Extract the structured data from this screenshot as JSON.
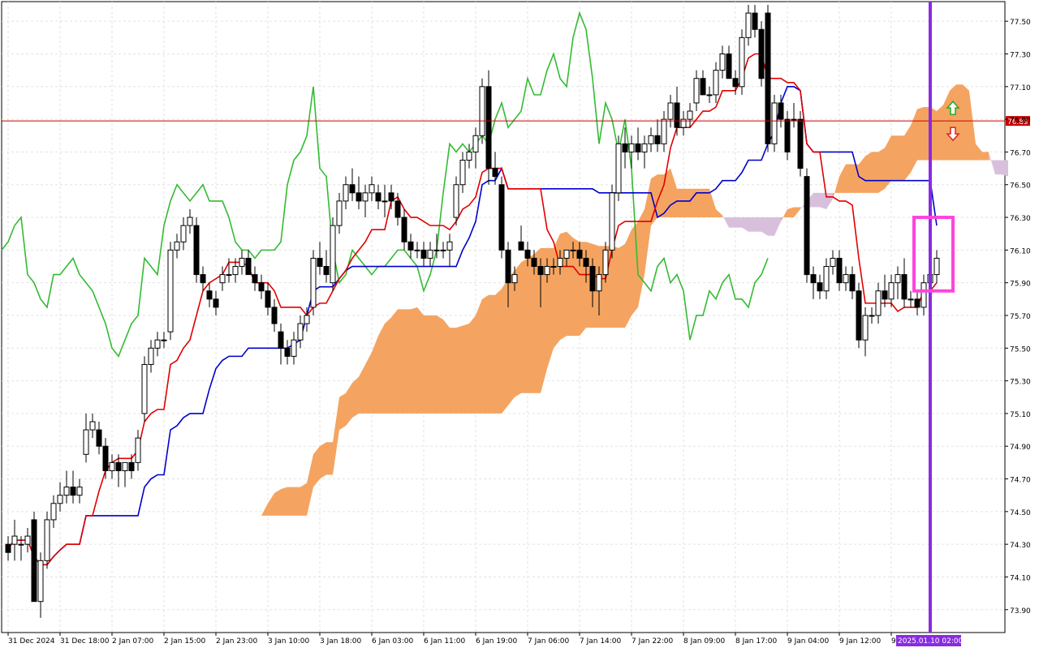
{
  "chart_data": {
    "type": "candlestick",
    "instrument_timeframe": "H1",
    "ylim": [
      73.76,
      77.62
    ],
    "y_ticks": [
      "77.50",
      "77.30",
      "77.10",
      "76.90",
      "76.70",
      "76.50",
      "76.30",
      "76.10",
      "75.90",
      "75.70",
      "75.50",
      "75.30",
      "75.10",
      "74.90",
      "74.70",
      "74.50",
      "74.30",
      "74.10",
      "73.90"
    ],
    "x_tick_labels": [
      "31 Dec 2024",
      "31 Dec 18:00",
      "2 Jan 07:00",
      "2 Jan 15:00",
      "2 Jan 23:00",
      "3 Jan 10:00",
      "3 Jan 18:00",
      "6 Jan 03:00",
      "6 Jan 11:00",
      "6 Jan 19:00",
      "7 Jan 06:00",
      "7 Jan 14:00",
      "7 Jan 22:00",
      "8 Jan 09:00",
      "8 Jan 17:00",
      "9 Jan 04:00",
      "9 Jan 12:00",
      "9"
    ],
    "x_tick_bar_index": [
      0,
      8,
      16,
      24,
      32,
      40,
      48,
      56,
      64,
      72,
      80,
      88,
      96,
      104,
      112,
      120,
      128,
      136
    ],
    "current_price": {
      "value": 76.89,
      "label": "76.89"
    },
    "vertical_marker": {
      "label": "2025.01.10 02:00",
      "bar_index": 142
    },
    "grid": true,
    "candles": [
      {
        "o": 74.3,
        "h": 74.35,
        "l": 74.2,
        "c": 74.25
      },
      {
        "o": 74.3,
        "h": 74.45,
        "l": 74.2,
        "c": 74.35
      },
      {
        "o": 74.3,
        "h": 74.35,
        "l": 74.2,
        "c": 74.3
      },
      {
        "o": 74.3,
        "h": 74.4,
        "l": 74.25,
        "c": 74.35
      },
      {
        "o": 74.45,
        "h": 74.5,
        "l": 73.95,
        "c": 73.95
      },
      {
        "o": 73.95,
        "h": 74.25,
        "l": 73.85,
        "c": 74.2
      },
      {
        "o": 74.2,
        "h": 74.5,
        "l": 74.15,
        "c": 74.45
      },
      {
        "o": 74.45,
        "h": 74.6,
        "l": 74.4,
        "c": 74.55
      },
      {
        "o": 74.55,
        "h": 74.68,
        "l": 74.5,
        "c": 74.6
      },
      {
        "o": 74.6,
        "h": 74.75,
        "l": 74.55,
        "c": 74.65
      },
      {
        "o": 74.65,
        "h": 74.75,
        "l": 74.55,
        "c": 74.6
      },
      {
        "o": 74.6,
        "h": 74.7,
        "l": 74.55,
        "c": 74.65
      },
      {
        "o": 74.85,
        "h": 75.1,
        "l": 74.8,
        "c": 75.0
      },
      {
        "o": 75.0,
        "h": 75.1,
        "l": 74.95,
        "c": 75.05
      },
      {
        "o": 75.0,
        "h": 75.05,
        "l": 74.85,
        "c": 74.9
      },
      {
        "o": 74.9,
        "h": 74.95,
        "l": 74.7,
        "c": 74.75
      },
      {
        "o": 74.75,
        "h": 74.85,
        "l": 74.7,
        "c": 74.8
      },
      {
        "o": 74.8,
        "h": 74.85,
        "l": 74.65,
        "c": 74.75
      },
      {
        "o": 74.75,
        "h": 74.8,
        "l": 74.65,
        "c": 74.8
      },
      {
        "o": 74.8,
        "h": 74.85,
        "l": 74.7,
        "c": 74.75
      },
      {
        "o": 74.8,
        "h": 75.0,
        "l": 74.75,
        "c": 74.95
      },
      {
        "o": 75.1,
        "h": 75.45,
        "l": 75.05,
        "c": 75.4
      },
      {
        "o": 75.4,
        "h": 75.55,
        "l": 75.35,
        "c": 75.5
      },
      {
        "o": 75.5,
        "h": 75.6,
        "l": 75.45,
        "c": 75.55
      },
      {
        "o": 75.55,
        "h": 75.6,
        "l": 75.5,
        "c": 75.55
      },
      {
        "o": 75.6,
        "h": 76.15,
        "l": 75.55,
        "c": 76.1
      },
      {
        "o": 76.1,
        "h": 76.2,
        "l": 76.05,
        "c": 76.15
      },
      {
        "o": 76.15,
        "h": 76.3,
        "l": 76.1,
        "c": 76.25
      },
      {
        "o": 76.25,
        "h": 76.35,
        "l": 76.2,
        "c": 76.3
      },
      {
        "o": 76.25,
        "h": 76.3,
        "l": 75.9,
        "c": 75.95
      },
      {
        "o": 75.95,
        "h": 76.0,
        "l": 75.85,
        "c": 75.9
      },
      {
        "o": 75.85,
        "h": 75.9,
        "l": 75.75,
        "c": 75.8
      },
      {
        "o": 75.8,
        "h": 75.85,
        "l": 75.7,
        "c": 75.75
      },
      {
        "o": 75.9,
        "h": 76.0,
        "l": 75.85,
        "c": 75.95
      },
      {
        "o": 75.95,
        "h": 76.05,
        "l": 75.9,
        "c": 75.95
      },
      {
        "o": 75.95,
        "h": 76.05,
        "l": 75.9,
        "c": 76.0
      },
      {
        "o": 76.0,
        "h": 76.1,
        "l": 75.95,
        "c": 76.05
      },
      {
        "o": 76.05,
        "h": 76.1,
        "l": 75.95,
        "c": 75.95
      },
      {
        "o": 75.95,
        "h": 76.0,
        "l": 75.85,
        "c": 75.9
      },
      {
        "o": 75.9,
        "h": 75.95,
        "l": 75.8,
        "c": 75.85
      },
      {
        "o": 75.85,
        "h": 75.9,
        "l": 75.7,
        "c": 75.75
      },
      {
        "o": 75.75,
        "h": 75.8,
        "l": 75.6,
        "c": 75.65
      },
      {
        "o": 75.6,
        "h": 75.65,
        "l": 75.4,
        "c": 75.5
      },
      {
        "o": 75.5,
        "h": 75.55,
        "l": 75.4,
        "c": 75.45
      },
      {
        "o": 75.45,
        "h": 75.6,
        "l": 75.4,
        "c": 75.55
      },
      {
        "o": 75.55,
        "h": 75.7,
        "l": 75.5,
        "c": 75.65
      },
      {
        "o": 75.65,
        "h": 75.75,
        "l": 75.6,
        "c": 75.7
      },
      {
        "o": 75.75,
        "h": 76.1,
        "l": 75.7,
        "c": 76.05
      },
      {
        "o": 76.05,
        "h": 76.15,
        "l": 75.95,
        "c": 76.0
      },
      {
        "o": 76.0,
        "h": 76.1,
        "l": 75.9,
        "c": 75.95
      },
      {
        "o": 75.9,
        "h": 76.3,
        "l": 75.85,
        "c": 76.25
      },
      {
        "o": 76.25,
        "h": 76.45,
        "l": 76.2,
        "c": 76.4
      },
      {
        "o": 76.4,
        "h": 76.55,
        "l": 76.35,
        "c": 76.5
      },
      {
        "o": 76.5,
        "h": 76.6,
        "l": 76.4,
        "c": 76.45
      },
      {
        "o": 76.45,
        "h": 76.55,
        "l": 76.35,
        "c": 76.4
      },
      {
        "o": 76.4,
        "h": 76.5,
        "l": 76.3,
        "c": 76.45
      },
      {
        "o": 76.45,
        "h": 76.55,
        "l": 76.4,
        "c": 76.5
      },
      {
        "o": 76.45,
        "h": 76.5,
        "l": 76.35,
        "c": 76.4
      },
      {
        "o": 76.4,
        "h": 76.5,
        "l": 76.3,
        "c": 76.4
      },
      {
        "o": 76.45,
        "h": 76.5,
        "l": 76.35,
        "c": 76.4
      },
      {
        "o": 76.4,
        "h": 76.45,
        "l": 76.25,
        "c": 76.3
      },
      {
        "o": 76.3,
        "h": 76.35,
        "l": 76.1,
        "c": 76.15
      },
      {
        "o": 76.15,
        "h": 76.2,
        "l": 76.05,
        "c": 76.1
      },
      {
        "o": 76.1,
        "h": 76.15,
        "l": 76.05,
        "c": 76.1
      },
      {
        "o": 76.1,
        "h": 76.15,
        "l": 76.0,
        "c": 76.05
      },
      {
        "o": 76.05,
        "h": 76.15,
        "l": 76.0,
        "c": 76.1
      },
      {
        "o": 76.1,
        "h": 76.2,
        "l": 76.05,
        "c": 76.1
      },
      {
        "o": 76.1,
        "h": 76.15,
        "l": 76.05,
        "c": 76.1
      },
      {
        "o": 76.1,
        "h": 76.2,
        "l": 76.0,
        "c": 76.15
      },
      {
        "o": 76.3,
        "h": 76.55,
        "l": 76.25,
        "c": 76.5
      },
      {
        "o": 76.5,
        "h": 76.7,
        "l": 76.45,
        "c": 76.65
      },
      {
        "o": 76.65,
        "h": 76.75,
        "l": 76.6,
        "c": 76.7
      },
      {
        "o": 76.7,
        "h": 76.85,
        "l": 76.6,
        "c": 76.8
      },
      {
        "o": 76.8,
        "h": 77.15,
        "l": 76.75,
        "c": 77.1
      },
      {
        "o": 77.1,
        "h": 77.2,
        "l": 76.5,
        "c": 76.6
      },
      {
        "o": 76.6,
        "h": 76.7,
        "l": 76.5,
        "c": 76.55
      },
      {
        "o": 76.5,
        "h": 76.55,
        "l": 76.05,
        "c": 76.1
      },
      {
        "o": 76.1,
        "h": 76.15,
        "l": 75.75,
        "c": 75.9
      },
      {
        "o": 75.9,
        "h": 76.0,
        "l": 75.85,
        "c": 75.95
      },
      {
        "o": 76.15,
        "h": 76.25,
        "l": 76.1,
        "c": 76.1
      },
      {
        "o": 76.1,
        "h": 76.15,
        "l": 76.0,
        "c": 76.05
      },
      {
        "o": 76.05,
        "h": 76.1,
        "l": 75.95,
        "c": 76.0
      },
      {
        "o": 76.0,
        "h": 76.05,
        "l": 75.75,
        "c": 75.95
      },
      {
        "o": 75.95,
        "h": 76.05,
        "l": 75.9,
        "c": 76.0
      },
      {
        "o": 76.0,
        "h": 76.05,
        "l": 75.95,
        "c": 76.0
      },
      {
        "o": 76.0,
        "h": 76.1,
        "l": 75.95,
        "c": 76.05
      },
      {
        "o": 76.05,
        "h": 76.1,
        "l": 76.0,
        "c": 76.1
      },
      {
        "o": 76.1,
        "h": 76.15,
        "l": 76.05,
        "c": 76.1
      },
      {
        "o": 76.1,
        "h": 76.15,
        "l": 76.0,
        "c": 76.05
      },
      {
        "o": 76.05,
        "h": 76.1,
        "l": 75.9,
        "c": 76.0
      },
      {
        "o": 76.0,
        "h": 76.05,
        "l": 75.75,
        "c": 75.85
      },
      {
        "o": 75.85,
        "h": 76.0,
        "l": 75.7,
        "c": 75.95
      },
      {
        "o": 75.95,
        "h": 76.15,
        "l": 75.9,
        "c": 76.1
      },
      {
        "o": 76.1,
        "h": 76.5,
        "l": 76.05,
        "c": 76.45
      },
      {
        "o": 76.45,
        "h": 76.8,
        "l": 76.4,
        "c": 76.75
      },
      {
        "o": 76.75,
        "h": 76.85,
        "l": 76.6,
        "c": 76.7
      },
      {
        "o": 76.7,
        "h": 76.8,
        "l": 76.6,
        "c": 76.75
      },
      {
        "o": 76.75,
        "h": 76.85,
        "l": 76.65,
        "c": 76.7
      },
      {
        "o": 76.7,
        "h": 76.8,
        "l": 76.6,
        "c": 76.75
      },
      {
        "o": 76.75,
        "h": 76.85,
        "l": 76.7,
        "c": 76.8
      },
      {
        "o": 76.8,
        "h": 76.9,
        "l": 76.7,
        "c": 76.75
      },
      {
        "o": 76.75,
        "h": 76.95,
        "l": 76.7,
        "c": 76.9
      },
      {
        "o": 76.9,
        "h": 77.05,
        "l": 76.85,
        "c": 77.0
      },
      {
        "o": 77.0,
        "h": 77.1,
        "l": 76.8,
        "c": 76.85
      },
      {
        "o": 76.85,
        "h": 76.95,
        "l": 76.8,
        "c": 76.9
      },
      {
        "o": 76.9,
        "h": 77.0,
        "l": 76.85,
        "c": 76.95
      },
      {
        "o": 77.0,
        "h": 77.2,
        "l": 76.95,
        "c": 77.15
      },
      {
        "o": 77.15,
        "h": 77.2,
        "l": 77.05,
        "c": 77.05
      },
      {
        "o": 77.05,
        "h": 77.1,
        "l": 77.0,
        "c": 77.05
      },
      {
        "o": 77.05,
        "h": 77.25,
        "l": 77.0,
        "c": 77.2
      },
      {
        "o": 77.2,
        "h": 77.35,
        "l": 77.15,
        "c": 77.3
      },
      {
        "o": 77.3,
        "h": 77.35,
        "l": 77.15,
        "c": 77.15
      },
      {
        "o": 77.15,
        "h": 77.2,
        "l": 77.05,
        "c": 77.1
      },
      {
        "o": 77.1,
        "h": 77.45,
        "l": 77.05,
        "c": 77.4
      },
      {
        "o": 77.4,
        "h": 77.6,
        "l": 77.35,
        "c": 77.55
      },
      {
        "o": 77.55,
        "h": 77.6,
        "l": 77.4,
        "c": 77.45
      },
      {
        "o": 77.45,
        "h": 77.5,
        "l": 77.1,
        "c": 77.15
      },
      {
        "o": 77.55,
        "h": 77.6,
        "l": 76.7,
        "c": 76.75
      },
      {
        "o": 76.75,
        "h": 77.05,
        "l": 76.7,
        "c": 77.0
      },
      {
        "o": 77.0,
        "h": 77.05,
        "l": 76.85,
        "c": 76.9
      },
      {
        "o": 76.9,
        "h": 76.95,
        "l": 76.65,
        "c": 76.7
      },
      {
        "o": 76.9,
        "h": 77.0,
        "l": 76.85,
        "c": 76.9
      },
      {
        "o": 76.9,
        "h": 76.95,
        "l": 76.55,
        "c": 76.6
      },
      {
        "o": 76.55,
        "h": 76.6,
        "l": 75.9,
        "c": 75.95
      },
      {
        "o": 75.95,
        "h": 76.0,
        "l": 75.8,
        "c": 75.9
      },
      {
        "o": 75.9,
        "h": 75.95,
        "l": 75.8,
        "c": 75.85
      },
      {
        "o": 75.85,
        "h": 76.05,
        "l": 75.8,
        "c": 76.0
      },
      {
        "o": 76.0,
        "h": 76.1,
        "l": 75.95,
        "c": 76.05
      },
      {
        "o": 76.05,
        "h": 76.1,
        "l": 75.85,
        "c": 75.9
      },
      {
        "o": 75.9,
        "h": 76.0,
        "l": 75.85,
        "c": 75.95
      },
      {
        "o": 75.95,
        "h": 76.0,
        "l": 75.8,
        "c": 75.85
      },
      {
        "o": 75.85,
        "h": 75.9,
        "l": 75.5,
        "c": 75.55
      },
      {
        "o": 75.55,
        "h": 75.75,
        "l": 75.45,
        "c": 75.7
      },
      {
        "o": 75.7,
        "h": 75.75,
        "l": 75.65,
        "c": 75.7
      },
      {
        "o": 75.7,
        "h": 75.9,
        "l": 75.65,
        "c": 75.85
      },
      {
        "o": 75.85,
        "h": 75.95,
        "l": 75.75,
        "c": 75.8
      },
      {
        "o": 75.8,
        "h": 75.95,
        "l": 75.75,
        "c": 75.9
      },
      {
        "o": 75.9,
        "h": 76.0,
        "l": 75.8,
        "c": 75.95
      },
      {
        "o": 75.95,
        "h": 76.05,
        "l": 75.75,
        "c": 75.8
      },
      {
        "o": 75.8,
        "h": 75.85,
        "l": 75.75,
        "c": 75.8
      },
      {
        "o": 75.8,
        "h": 75.85,
        "l": 75.7,
        "c": 75.75
      },
      {
        "o": 75.75,
        "h": 75.95,
        "l": 75.7,
        "c": 75.9
      },
      {
        "o": 75.9,
        "h": 76.0,
        "l": 75.85,
        "c": 75.95
      },
      {
        "o": 75.95,
        "h": 76.1,
        "l": 75.9,
        "c": 76.05
      }
    ],
    "colors": {
      "bull_body": "#ffffff",
      "bear_body": "#000000",
      "tenkan": "#e00000",
      "kijun": "#0000cc",
      "chikou": "#33bb33",
      "cloud_bull": "#f4a460",
      "cloud_bear": "#d8c0dc",
      "price_line": "#cc0000",
      "marker": "#8a2be2",
      "highlight_box": "#ff44dd",
      "grid": "#e2e2e2"
    }
  }
}
